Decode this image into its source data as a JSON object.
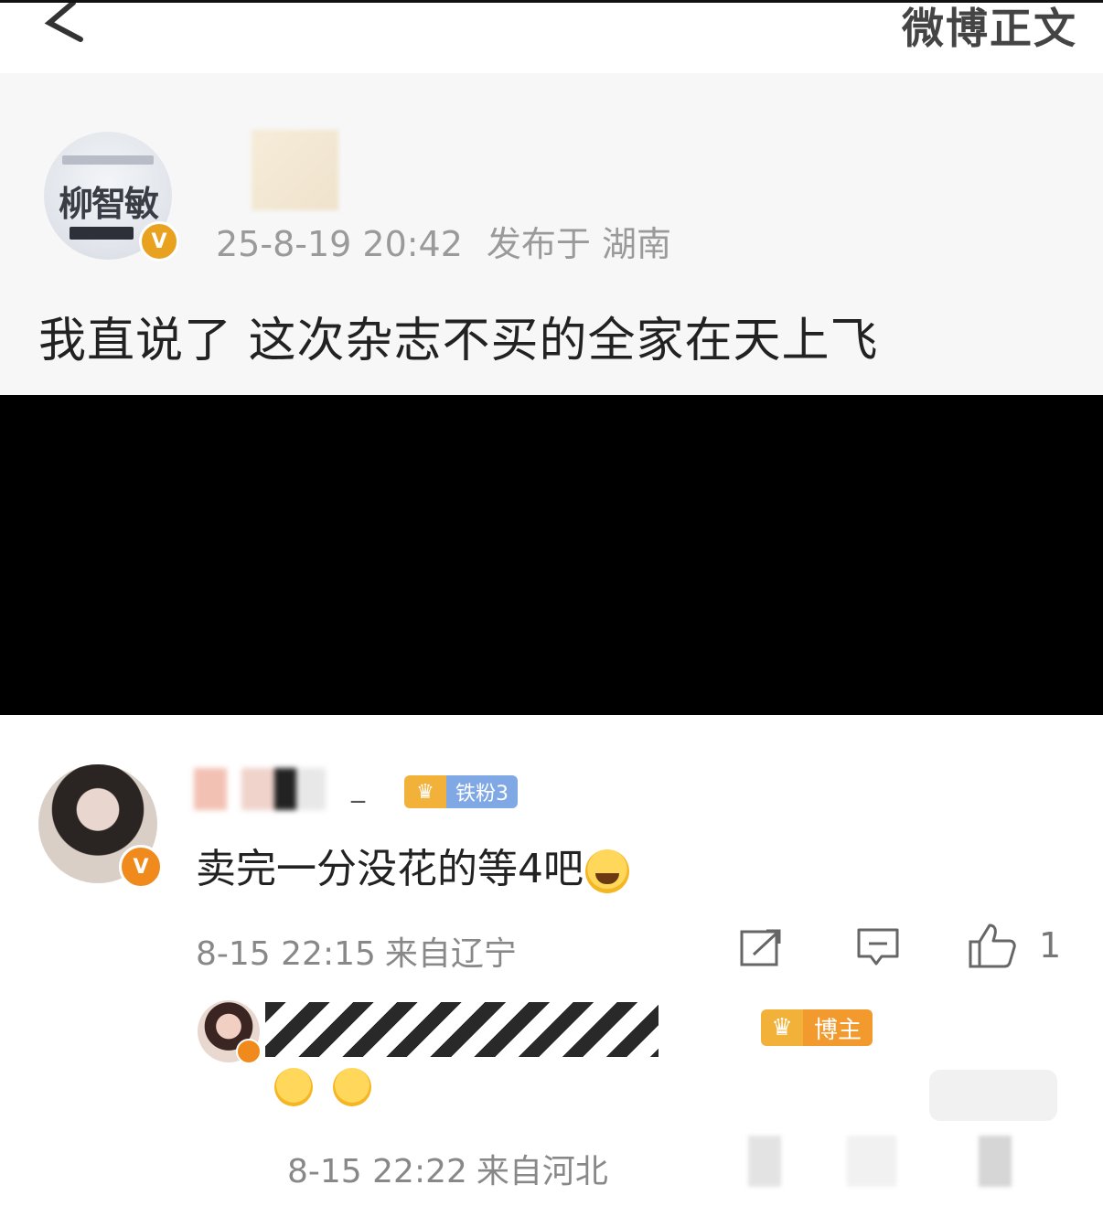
{
  "header": {
    "back_icon": "back-arrow-icon",
    "title": "微博正文"
  },
  "post": {
    "avatar_text": "柳智敏",
    "timestamp": "25-8-19 20:42",
    "location": "发布于 湖南",
    "text": "我直说了 这次杂志不买的全家在天上飞",
    "verified_badge": "V"
  },
  "comment": {
    "name_suffix": "_",
    "fan_badge": "铁粉3",
    "text": "卖完一分没花的等4吧",
    "emoji": "laugh-cry-emoji",
    "time": "8-15 22:15",
    "location": "来自辽宁",
    "like_count": "1",
    "verified_badge": "V"
  },
  "reply": {
    "host_badge": "博主",
    "time": "8-15 22:22",
    "location": "来自河北"
  },
  "colors": {
    "verified_gold": "#e9a21f",
    "verified_orange": "#f08a1c",
    "fan_badge_blue": "#7fa8e4",
    "host_badge_orange": "#f29a2e",
    "meta_gray": "#888888"
  }
}
